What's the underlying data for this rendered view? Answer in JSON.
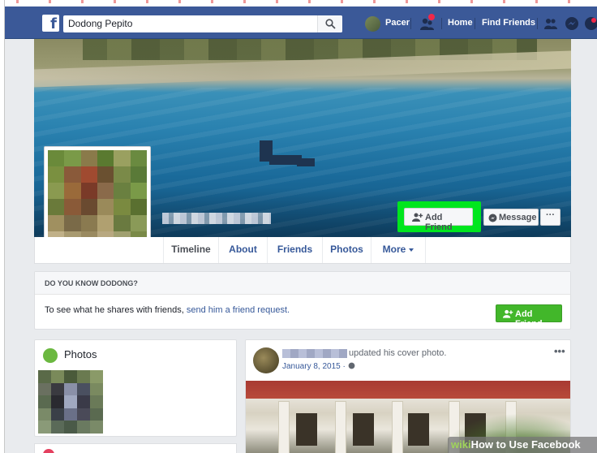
{
  "topbar": {
    "search_value": "Dodong Pepito",
    "user_name": "Pacer",
    "home_label": "Home",
    "find_friends_label": "Find Friends"
  },
  "cover": {
    "add_friend_label": "Add Friend",
    "message_label": "Message",
    "more_label": "···"
  },
  "tabs": [
    {
      "label": "Timeline"
    },
    {
      "label": "About"
    },
    {
      "label": "Friends"
    },
    {
      "label": "Photos"
    },
    {
      "label": "More"
    }
  ],
  "know": {
    "title": "DO YOU KNOW DODONG?",
    "text": "To see what he shares with friends, ",
    "link": "send him a friend request.",
    "button_label": "Add Friend"
  },
  "photos": {
    "title": "Photos"
  },
  "post": {
    "action": "updated his cover photo.",
    "date": "January 8, 2015 · ",
    "menu": "•••"
  },
  "watermark": {
    "wiki": "wiki",
    "text": "How to Use Facebook"
  },
  "colors": {
    "brand": "#3b5998",
    "highlight": "#00e61e",
    "add_friend_green": "#42b72a"
  }
}
